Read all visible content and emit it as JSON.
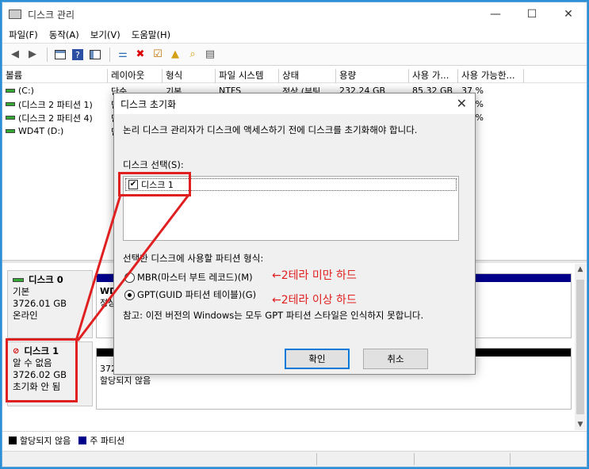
{
  "window": {
    "title": "디스크 관리",
    "controls": [
      "—",
      "☐",
      "✕"
    ]
  },
  "menu": [
    "파일(F)",
    "동작(A)",
    "보기(V)",
    "도움말(H)"
  ],
  "toolbar": {
    "icons": [
      "back-arrow-icon",
      "forward-arrow-icon",
      "panel-icon",
      "help-icon",
      "panel2-icon",
      "connect-icon",
      "delete-icon",
      "check-doc-icon",
      "up-folder-icon",
      "search-doc-icon",
      "properties-icon"
    ]
  },
  "volume_table": {
    "columns": [
      "볼륨",
      "레이아웃",
      "형식",
      "파일 시스템",
      "상태",
      "용량",
      "사용 가...",
      "사용 가능한..."
    ],
    "rows": [
      {
        "name": "(C:)",
        "layout": "단순",
        "type": "기본",
        "fs": "NTFS",
        "status": "정상 (부팅,",
        "capacity": "232.24 GB",
        "free": "85.32 GB",
        "pct": "37 %"
      },
      {
        "name": "(디스크 2 파티션 1)",
        "layout": "단",
        "type": "",
        "fs": "",
        "status": "",
        "capacity": "",
        "free": "",
        "pct": "00 %"
      },
      {
        "name": "(디스크 2 파티션 4)",
        "layout": "단",
        "type": "",
        "fs": "",
        "status": "",
        "capacity": "",
        "free": "",
        "pct": "00 %"
      },
      {
        "name": "WD4T (D:)",
        "layout": "단",
        "type": "",
        "fs": "",
        "status": "",
        "capacity": "",
        "free": "",
        "pct": "%"
      }
    ]
  },
  "disks": [
    {
      "name": "디스크 0",
      "type": "기본",
      "size": "3726.01 GB",
      "state": "온라인",
      "part_name": "WD",
      "part_extra": "정상"
    },
    {
      "name": "디스크 1",
      "type": "알 수 없음",
      "size": "3726.02 GB",
      "state": "초기화 안 됨",
      "part_size": "3726.02 GB",
      "part_state": "할당되지 않음"
    }
  ],
  "legend": {
    "unallocated": "할당되지 않음",
    "primary": "주 파티션",
    "colors": {
      "unallocated": "#000000",
      "primary": "#00008b"
    }
  },
  "dialog": {
    "title": "디스크 초기화",
    "intro": "논리 디스크 관리자가 디스크에 액세스하기 전에 디스크를 초기화해야 합니다.",
    "select_label": "디스크 선택(S):",
    "disk_item": "디스크 1",
    "disk_item_checked": true,
    "partition_label": "선택한 디스크에 사용할 파티션 형식:",
    "mbr_label": "MBR(마스터 부트 레코드)(M)",
    "gpt_label": "GPT(GUID 파티션 테이블)(G)",
    "note": "참고: 이전 버전의 Windows는 모두 GPT 파티션 스타일은 인식하지 못합니다.",
    "ok": "확인",
    "cancel": "취소"
  },
  "annotations": {
    "mbr_note": "←2테라 미만 하드",
    "gpt_note": "←2테라 이상 하드",
    "color": "#e02020"
  }
}
